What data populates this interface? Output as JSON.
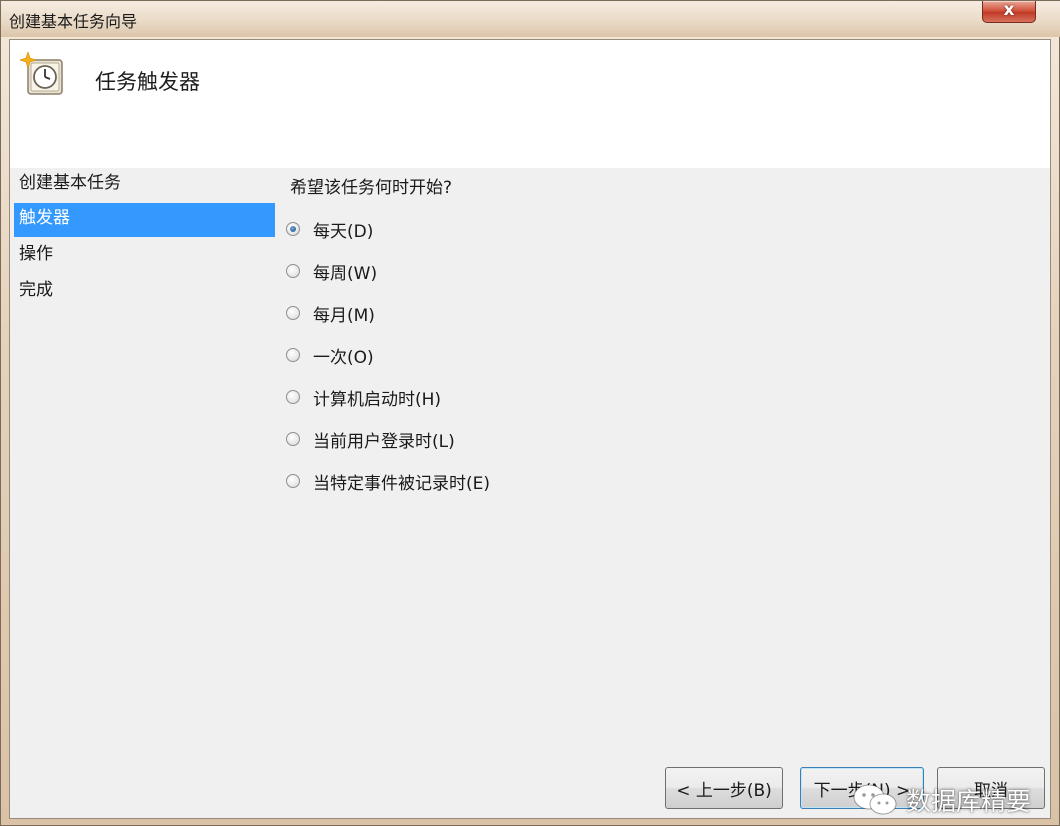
{
  "window": {
    "title": "创建基本任务向导",
    "close_label": "x"
  },
  "header": {
    "title": "任务触发器",
    "icon": "scheduled-task-clock-icon"
  },
  "sidebar": {
    "items": [
      {
        "label": "创建基本任务",
        "selected": false
      },
      {
        "label": "触发器",
        "selected": true
      },
      {
        "label": "操作",
        "selected": false
      },
      {
        "label": "完成",
        "selected": false
      }
    ]
  },
  "main": {
    "question": "希望该任务何时开始?",
    "options": [
      {
        "label": "每天(D)",
        "checked": true
      },
      {
        "label": "每周(W)",
        "checked": false
      },
      {
        "label": "每月(M)",
        "checked": false
      },
      {
        "label": "一次(O)",
        "checked": false
      },
      {
        "label": "计算机启动时(H)",
        "checked": false
      },
      {
        "label": "当前用户登录时(L)",
        "checked": false
      },
      {
        "label": "当特定事件被记录时(E)",
        "checked": false
      }
    ]
  },
  "footer": {
    "back_label": "< 上一步(B)",
    "next_label": "下一步(N) >",
    "cancel_label": "取消"
  },
  "watermark": {
    "text": "数据库精要",
    "icon": "wechat-icon"
  },
  "colors": {
    "selection": "#3399ff",
    "client_bg": "#f0f0f0",
    "close_button": "#c13b26"
  }
}
